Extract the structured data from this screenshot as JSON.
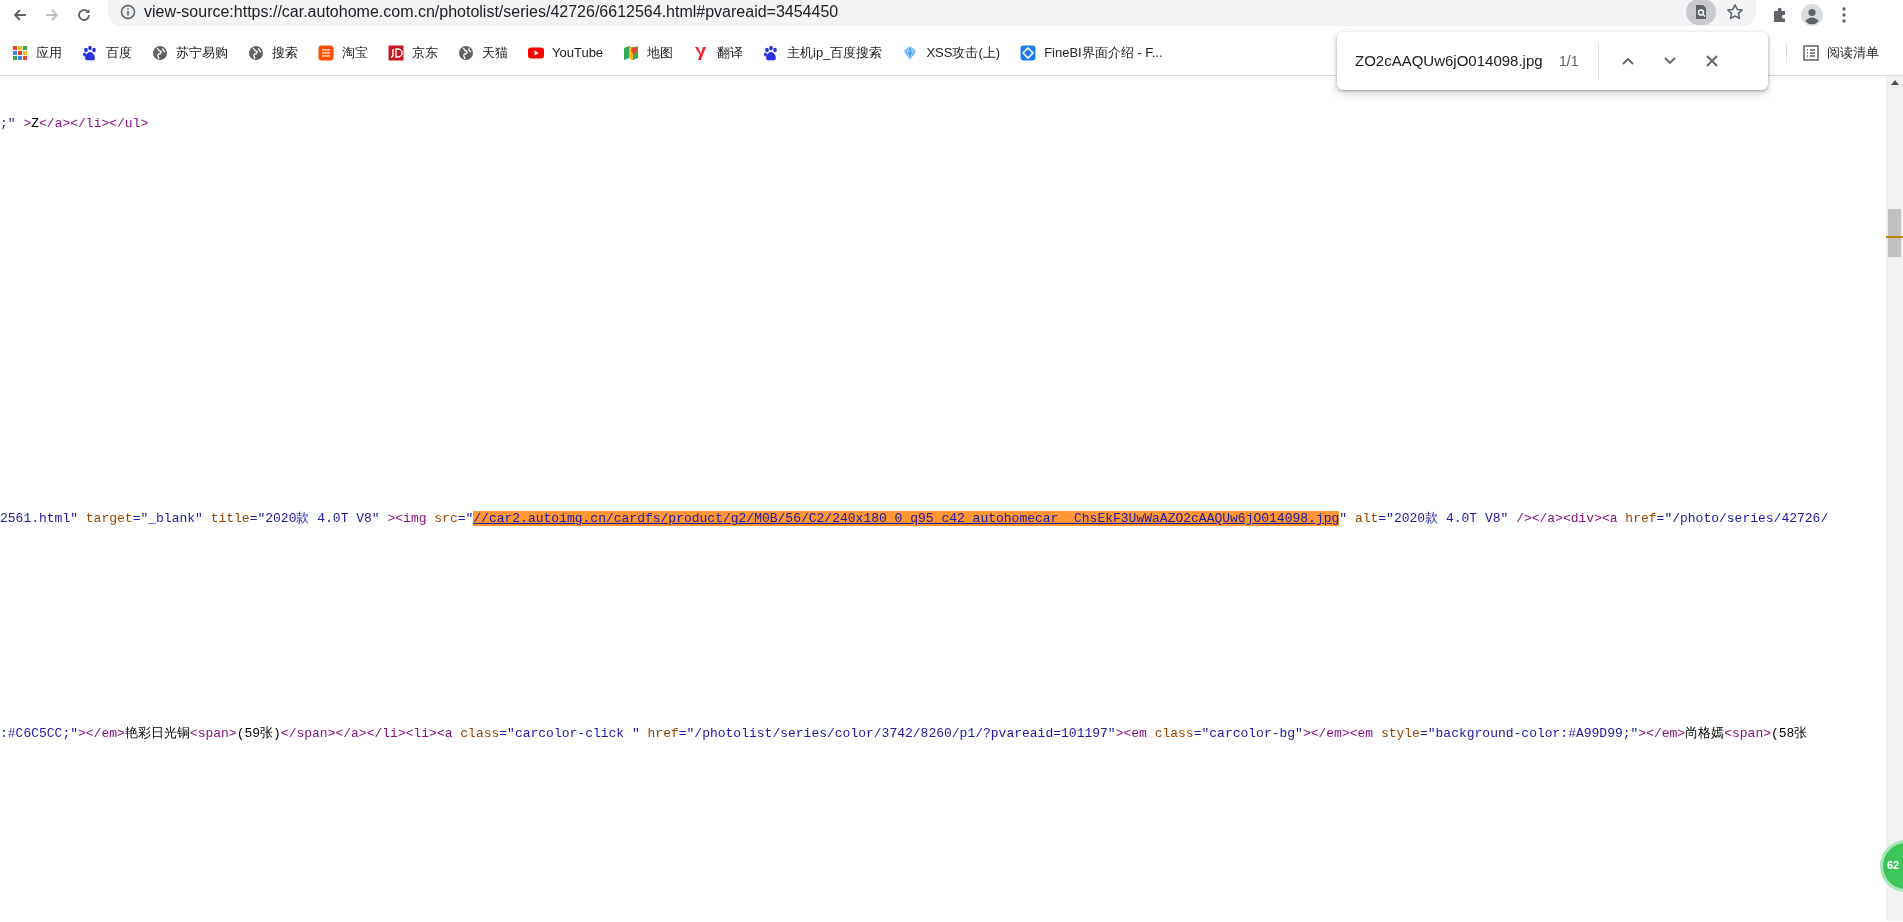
{
  "toolbar": {
    "url": "view-source:https://car.autohome.com.cn/photolist/series/42726/6612564.html#pvareaid=3454450",
    "find_active": true
  },
  "bookmarks": [
    {
      "kind": "apps",
      "label": "应用"
    },
    {
      "kind": "paw",
      "label": "百度"
    },
    {
      "kind": "globe",
      "label": "苏宁易购"
    },
    {
      "kind": "globe",
      "label": "搜索"
    },
    {
      "kind": "orange",
      "label": "淘宝"
    },
    {
      "kind": "red",
      "label": "京东"
    },
    {
      "kind": "globe",
      "label": "天猫"
    },
    {
      "kind": "play",
      "label": "YouTube"
    },
    {
      "kind": "map",
      "label": "地图"
    },
    {
      "kind": "letter",
      "label": "翻译"
    },
    {
      "kind": "paw",
      "label": "主机ip_百度搜索"
    },
    {
      "kind": "gem",
      "label": "XSS攻击(上)"
    },
    {
      "kind": "diamond",
      "label": "FineBI界面介绍 - F..."
    }
  ],
  "reading_list": {
    "label": "阅读清单"
  },
  "find_bar": {
    "query": "ZO2cAAQUw6jO014098.jpg",
    "count": "1/1"
  },
  "source_lines": [
    {
      "tokens": [
        {
          "kind": "value",
          "text": ";\""
        },
        {
          "kind": "tag",
          "text": " >"
        },
        {
          "kind": "text",
          "text": "Z"
        },
        {
          "kind": "tag",
          "text": "</a></li></ul>"
        }
      ]
    },
    {
      "tokens": [
        {
          "kind": "value",
          "text": "2561.html\""
        },
        {
          "kind": "attr",
          "text": " target"
        },
        {
          "kind": "value",
          "text": "=\"_blank\""
        },
        {
          "kind": "attr",
          "text": " title"
        },
        {
          "kind": "value",
          "text": "=\"2020款 4.0T V8\""
        },
        {
          "kind": "tag",
          "text": " ><img "
        },
        {
          "kind": "attr",
          "text": "src"
        },
        {
          "kind": "value",
          "text": "=\""
        },
        {
          "kind": "match",
          "text": "//car2.autoimg.cn/cardfs/product/g2/M0B/56/C2/240x180_0_q95_c42_autohomecar__ChsEkF3UwWaAZO2cAAQUw6jO014098.jpg"
        },
        {
          "kind": "value",
          "text": "\""
        },
        {
          "kind": "attr",
          "text": " alt"
        },
        {
          "kind": "value",
          "text": "=\"2020款 4.0T V8\""
        },
        {
          "kind": "tag",
          "text": " /></a><div><a "
        },
        {
          "kind": "attr",
          "text": "href"
        },
        {
          "kind": "value",
          "text": "=\"/photo/series/42726/"
        }
      ]
    },
    {
      "tokens": [
        {
          "kind": "value",
          "text": ":#C6C5CC;\""
        },
        {
          "kind": "tag",
          "text": "></em>"
        },
        {
          "kind": "text",
          "text": "艳彩日光铜"
        },
        {
          "kind": "tag",
          "text": "<span>"
        },
        {
          "kind": "text",
          "text": "(59张)"
        },
        {
          "kind": "tag",
          "text": "</span></a></li><li><a "
        },
        {
          "kind": "attr",
          "text": "class"
        },
        {
          "kind": "value",
          "text": "=\"carcolor-click \""
        },
        {
          "kind": "attr",
          "text": " href"
        },
        {
          "kind": "value",
          "text": "=\"/photolist/series/color/3742/8260/p1/?pvareaid=101197\""
        },
        {
          "kind": "tag",
          "text": "><em "
        },
        {
          "kind": "attr",
          "text": "class"
        },
        {
          "kind": "value",
          "text": "=\"carcolor-bg\""
        },
        {
          "kind": "tag",
          "text": "></em><em "
        },
        {
          "kind": "attr",
          "text": "style"
        },
        {
          "kind": "value",
          "text": "=\"background-color:#A99D99;\""
        },
        {
          "kind": "tag",
          "text": "></em>"
        },
        {
          "kind": "text",
          "text": "尚格嫣"
        },
        {
          "kind": "tag",
          "text": "<span>"
        },
        {
          "kind": "text",
          "text": "(58张"
        }
      ]
    }
  ],
  "floating_badge": {
    "text": "62"
  }
}
